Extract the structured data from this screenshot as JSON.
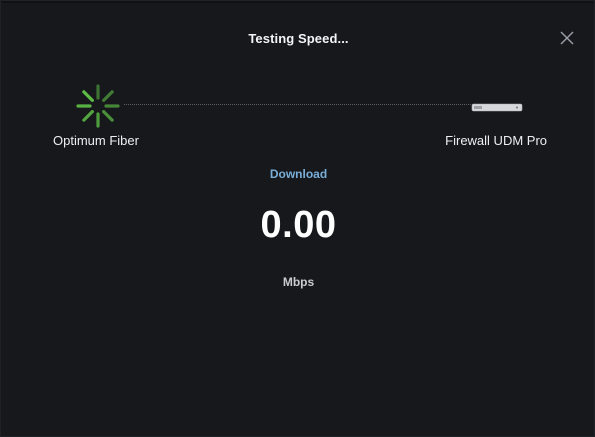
{
  "dialog": {
    "title": "Testing Speed...",
    "close_icon": "close-icon"
  },
  "path": {
    "source": {
      "label": "Optimum Fiber",
      "icon": "loading-spinner-icon",
      "color": "#5dbb46"
    },
    "destination": {
      "label": "Firewall UDM Pro",
      "icon": "rack-device-icon"
    }
  },
  "test": {
    "phase": "Download",
    "value": "0.00",
    "unit": "Mbps"
  },
  "colors": {
    "background": "#16181c",
    "accent": "#79aed8",
    "spinner": "#5dbb46"
  }
}
